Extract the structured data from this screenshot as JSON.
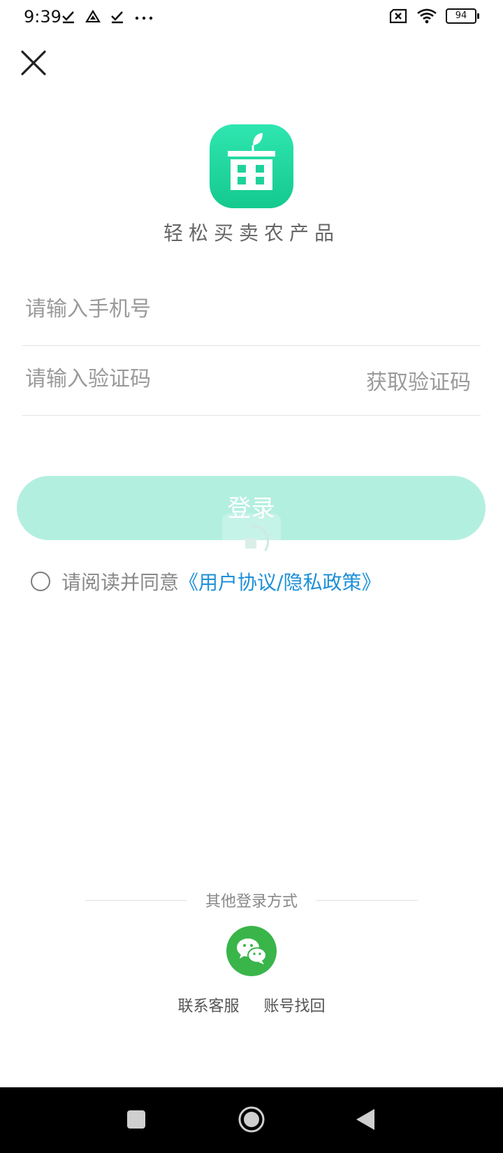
{
  "status_bar": {
    "time": "9:39",
    "battery": "94"
  },
  "app": {
    "slogan": "轻松买卖农产品"
  },
  "form": {
    "phone_placeholder": "请输入手机号",
    "code_placeholder": "请输入验证码",
    "get_code_label": "获取验证码",
    "login_label": "登录"
  },
  "agreement": {
    "prefix": "请阅读并同意",
    "link_text": "《用户协议/隐私政策》"
  },
  "other_login": {
    "title": "其他登录方式",
    "contact_label": "联系客服",
    "recover_label": "账号找回"
  },
  "colors": {
    "brand_green": "#21d6a0",
    "login_button": "#b3efdf",
    "link_blue": "#1e90d8",
    "wechat_green": "#39b54a"
  }
}
